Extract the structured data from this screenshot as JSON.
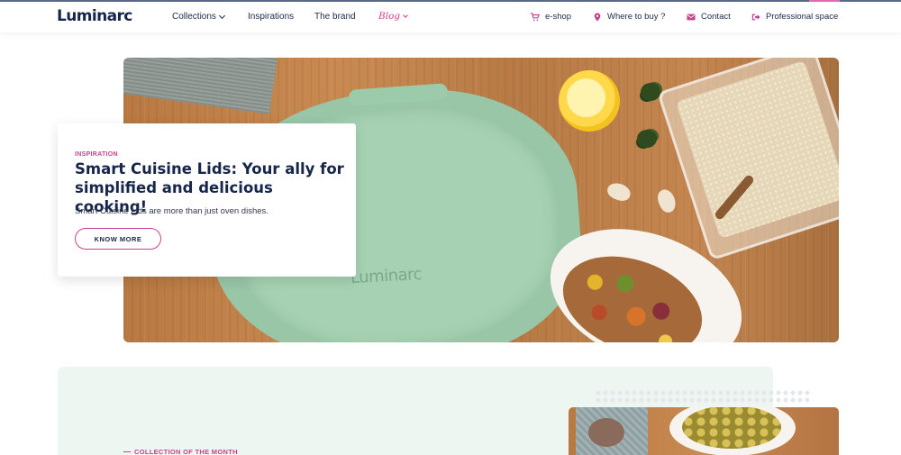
{
  "header": {
    "logo": "Luminarc",
    "nav": [
      {
        "label": "Collections",
        "has_dropdown": true
      },
      {
        "label": "Inspirations",
        "has_dropdown": false
      },
      {
        "label": "The brand",
        "has_dropdown": false
      },
      {
        "label": "Blog",
        "has_dropdown": true
      }
    ],
    "utility": [
      {
        "label": "e-shop",
        "icon": "cart-icon"
      },
      {
        "label": "Where to buy ?",
        "icon": "map-pin-icon"
      },
      {
        "label": "Contact",
        "icon": "envelope-icon"
      },
      {
        "label": "Professional space",
        "icon": "sign-in-icon"
      }
    ]
  },
  "hero": {
    "image_text": "Luminarc",
    "card": {
      "kicker": "INSPIRATION",
      "title": "Smart Cuisine Lids: Your ally for simplified and delicious cooking!",
      "text": "Smart Cuisine Lids are more than just oven dishes.",
      "button": "KNOW MORE"
    }
  },
  "collection": {
    "kicker": "COLLECTION OF THE MONTH"
  },
  "colors": {
    "accent": "#c4448f",
    "navy": "#16264a",
    "mint": "#eef6f2"
  }
}
